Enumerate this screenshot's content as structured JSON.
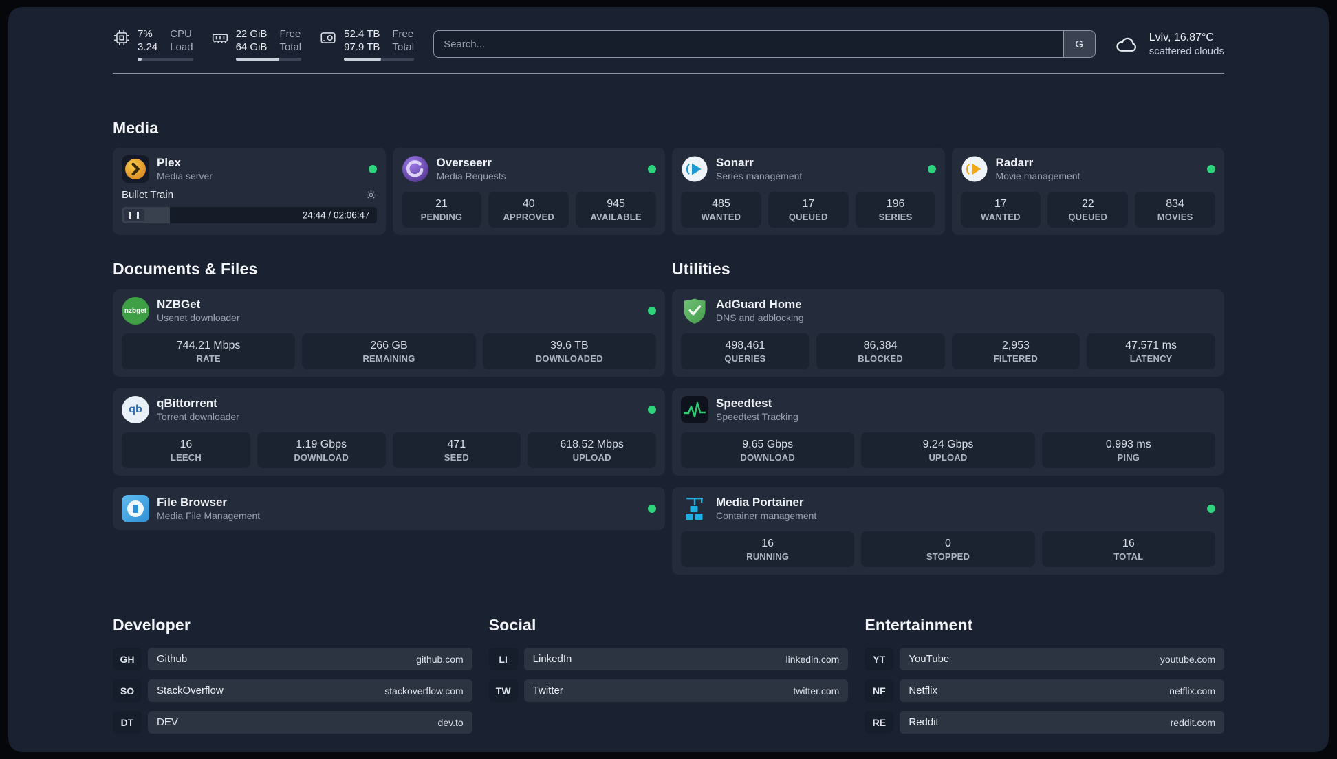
{
  "topbar": {
    "cpu": {
      "value1": "7%",
      "label1": "CPU",
      "value2": "3.24",
      "label2": "Load",
      "bar": 7
    },
    "ram": {
      "value1": "22 GiB",
      "label1": "Free",
      "value2": "64 GiB",
      "label2": "Total",
      "bar": 66
    },
    "disk": {
      "value1": "52.4 TB",
      "label1": "Free",
      "value2": "97.9 TB",
      "label2": "Total",
      "bar": 53
    },
    "search": {
      "placeholder": "Search...",
      "button": "G"
    },
    "weather": {
      "location": "Lviv, 16.87°C",
      "condition": "scattered clouds"
    }
  },
  "media": {
    "title": "Media",
    "plex": {
      "name": "Plex",
      "subtitle": "Media server",
      "track": "Bullet Train",
      "time": "24:44 / 02:06:47",
      "progress": 19
    },
    "overseerr": {
      "name": "Overseerr",
      "subtitle": "Media Requests",
      "stats": [
        {
          "value": "21",
          "label": "PENDING"
        },
        {
          "value": "40",
          "label": "APPROVED"
        },
        {
          "value": "945",
          "label": "AVAILABLE"
        }
      ]
    },
    "sonarr": {
      "name": "Sonarr",
      "subtitle": "Series management",
      "stats": [
        {
          "value": "485",
          "label": "WANTED"
        },
        {
          "value": "17",
          "label": "QUEUED"
        },
        {
          "value": "196",
          "label": "SERIES"
        }
      ]
    },
    "radarr": {
      "name": "Radarr",
      "subtitle": "Movie management",
      "stats": [
        {
          "value": "17",
          "label": "WANTED"
        },
        {
          "value": "22",
          "label": "QUEUED"
        },
        {
          "value": "834",
          "label": "MOVIES"
        }
      ]
    }
  },
  "documents": {
    "title": "Documents & Files",
    "nzbget": {
      "name": "NZBGet",
      "subtitle": "Usenet downloader",
      "icon_label": "nzbget",
      "stats": [
        {
          "value": "744.21 Mbps",
          "label": "RATE"
        },
        {
          "value": "266 GB",
          "label": "REMAINING"
        },
        {
          "value": "39.6 TB",
          "label": "DOWNLOADED"
        }
      ]
    },
    "qbittorrent": {
      "name": "qBittorrent",
      "subtitle": "Torrent downloader",
      "icon_label": "qb",
      "stats": [
        {
          "value": "16",
          "label": "LEECH"
        },
        {
          "value": "1.19 Gbps",
          "label": "DOWNLOAD"
        },
        {
          "value": "471",
          "label": "SEED"
        },
        {
          "value": "618.52 Mbps",
          "label": "UPLOAD"
        }
      ]
    },
    "filebrowser": {
      "name": "File Browser",
      "subtitle": "Media File Management"
    }
  },
  "utilities": {
    "title": "Utilities",
    "adguard": {
      "name": "AdGuard Home",
      "subtitle": "DNS and adblocking",
      "stats": [
        {
          "value": "498,461",
          "label": "QUERIES"
        },
        {
          "value": "86,384",
          "label": "BLOCKED"
        },
        {
          "value": "2,953",
          "label": "FILTERED"
        },
        {
          "value": "47.571 ms",
          "label": "LATENCY"
        }
      ]
    },
    "speedtest": {
      "name": "Speedtest",
      "subtitle": "Speedtest Tracking",
      "stats": [
        {
          "value": "9.65 Gbps",
          "label": "DOWNLOAD"
        },
        {
          "value": "9.24 Gbps",
          "label": "UPLOAD"
        },
        {
          "value": "0.993 ms",
          "label": "PING"
        }
      ]
    },
    "portainer": {
      "name": "Media Portainer",
      "subtitle": "Container management",
      "stats": [
        {
          "value": "16",
          "label": "RUNNING"
        },
        {
          "value": "0",
          "label": "STOPPED"
        },
        {
          "value": "16",
          "label": "TOTAL"
        }
      ]
    }
  },
  "bookmarks": {
    "developer": {
      "title": "Developer",
      "items": [
        {
          "abbr": "GH",
          "name": "Github",
          "url": "github.com"
        },
        {
          "abbr": "SO",
          "name": "StackOverflow",
          "url": "stackoverflow.com"
        },
        {
          "abbr": "DT",
          "name": "DEV",
          "url": "dev.to"
        }
      ]
    },
    "social": {
      "title": "Social",
      "items": [
        {
          "abbr": "LI",
          "name": "LinkedIn",
          "url": "linkedin.com"
        },
        {
          "abbr": "TW",
          "name": "Twitter",
          "url": "twitter.com"
        }
      ]
    },
    "entertainment": {
      "title": "Entertainment",
      "items": [
        {
          "abbr": "YT",
          "name": "YouTube",
          "url": "youtube.com"
        },
        {
          "abbr": "NF",
          "name": "Netflix",
          "url": "netflix.com"
        },
        {
          "abbr": "RE",
          "name": "Reddit",
          "url": "reddit.com"
        }
      ]
    }
  },
  "colors": {
    "status_online": "#2FD27D",
    "accent_green": "#2ECC71",
    "panel_bg": "#1A2232"
  }
}
